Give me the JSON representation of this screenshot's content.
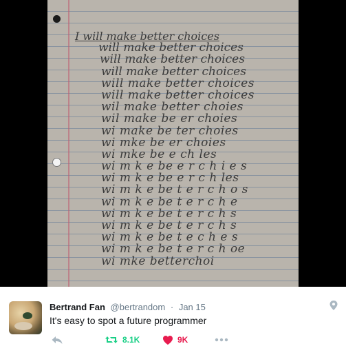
{
  "photo": {
    "title_line": "I will make better choices",
    "lines": [
      "will make better choices",
      "will make better choices",
      "will make better choices",
      "will make better choices",
      "will make better choices",
      "wil make better choies",
      "wil make be er choies",
      "wi make be ter choies",
      "wi mke be er choies",
      "wi mke be e ch les",
      "wi m k e be e r c h i e s",
      "wi m k e be e r c h les",
      "wi m k e be t e r c h o s",
      "wi m k e be t e r c h e",
      "wi m k e be t e r c h s",
      "wi m k e be t e r c h s",
      "wi m k e be t e c h e s",
      "wi m k e be t e r c h oe",
      "wi mke betterchoi"
    ]
  },
  "tweet": {
    "display_name": "Bertrand Fan",
    "handle": "@bertrandom",
    "separator": "·",
    "date": "Jan 15",
    "text": "It's easy to spot a future programmer",
    "retweet_count": "8.1K",
    "like_count": "9K"
  },
  "colors": {
    "retweet_green": "#19cf86",
    "like_red": "#e81c4f",
    "icon_gray": "#aab8c2"
  },
  "icons": [
    "location-pin-icon",
    "reply-icon",
    "retweet-icon",
    "heart-icon",
    "more-dots-icon"
  ]
}
